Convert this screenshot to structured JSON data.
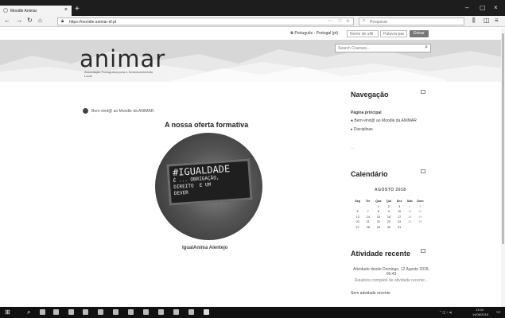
{
  "browser": {
    "tab_title": "Moodle Animar",
    "tab_close": "×",
    "new_tab": "+",
    "url": "https://moodle.animar-dl.pt",
    "url_menu": "···",
    "search_placeholder": "Pesquisar",
    "win_min": "–",
    "win_max": "▢",
    "win_close": "×"
  },
  "topbar": {
    "language": "Português - Portugal (pt)",
    "username_placeholder": "Nome de utili",
    "password_placeholder": "Palavra-passe",
    "login_label": "Entrar"
  },
  "header": {
    "logo": "animar",
    "tagline": "Associação Portuguesa para o Desenvolvimento Local",
    "search_placeholder": "Search Courses..."
  },
  "main": {
    "welcome": "Bem-vind@ ao Moodle da ANIMAR",
    "offer_title": "A nossa oferta formativa",
    "board_line1": "#IGUALDADE",
    "board_line2": "É ... OBRIGAÇÃO,",
    "board_line3": "DIREITO  E UM",
    "board_line4": "DEVER",
    "caption": "IgualAnima Alentejo"
  },
  "navigation": {
    "title": "Navegação",
    "home": "Página principal",
    "welcome_item": "Bem-vind@ ao Moodle da ANIMAR",
    "courses": "Disciplinas",
    "ellipsis": "..."
  },
  "calendar": {
    "title": "Calendário",
    "month": "AGOSTO 2018",
    "weekdays": [
      "Seg",
      "Ter",
      "Qua",
      "Qui",
      "Sex",
      "Sab",
      "Dom"
    ],
    "weeks": [
      [
        "",
        "",
        "1",
        "2",
        "3",
        "4",
        "5"
      ],
      [
        "6",
        "7",
        "8",
        "9",
        "10",
        "11",
        "12"
      ],
      [
        "13",
        "14",
        "15",
        "16",
        "17",
        "18",
        "19"
      ],
      [
        "20",
        "21",
        "22",
        "23",
        "24",
        "25",
        "26"
      ],
      [
        "27",
        "28",
        "29",
        "30",
        "31",
        "",
        ""
      ]
    ]
  },
  "recent": {
    "title": "Atividade recente",
    "since": "Atividade desde Domingo, 12 Agosto 2018, 06:43",
    "full_report": "Relatório completo de atividade recente...",
    "none": "Sem atividade recente"
  },
  "taskbar": {
    "time": "13:34",
    "date": "14/08/2018"
  },
  "colors": {
    "chrome_dark": "#1d1d1d",
    "login_button": "#777777",
    "banner": "#dddddd"
  }
}
